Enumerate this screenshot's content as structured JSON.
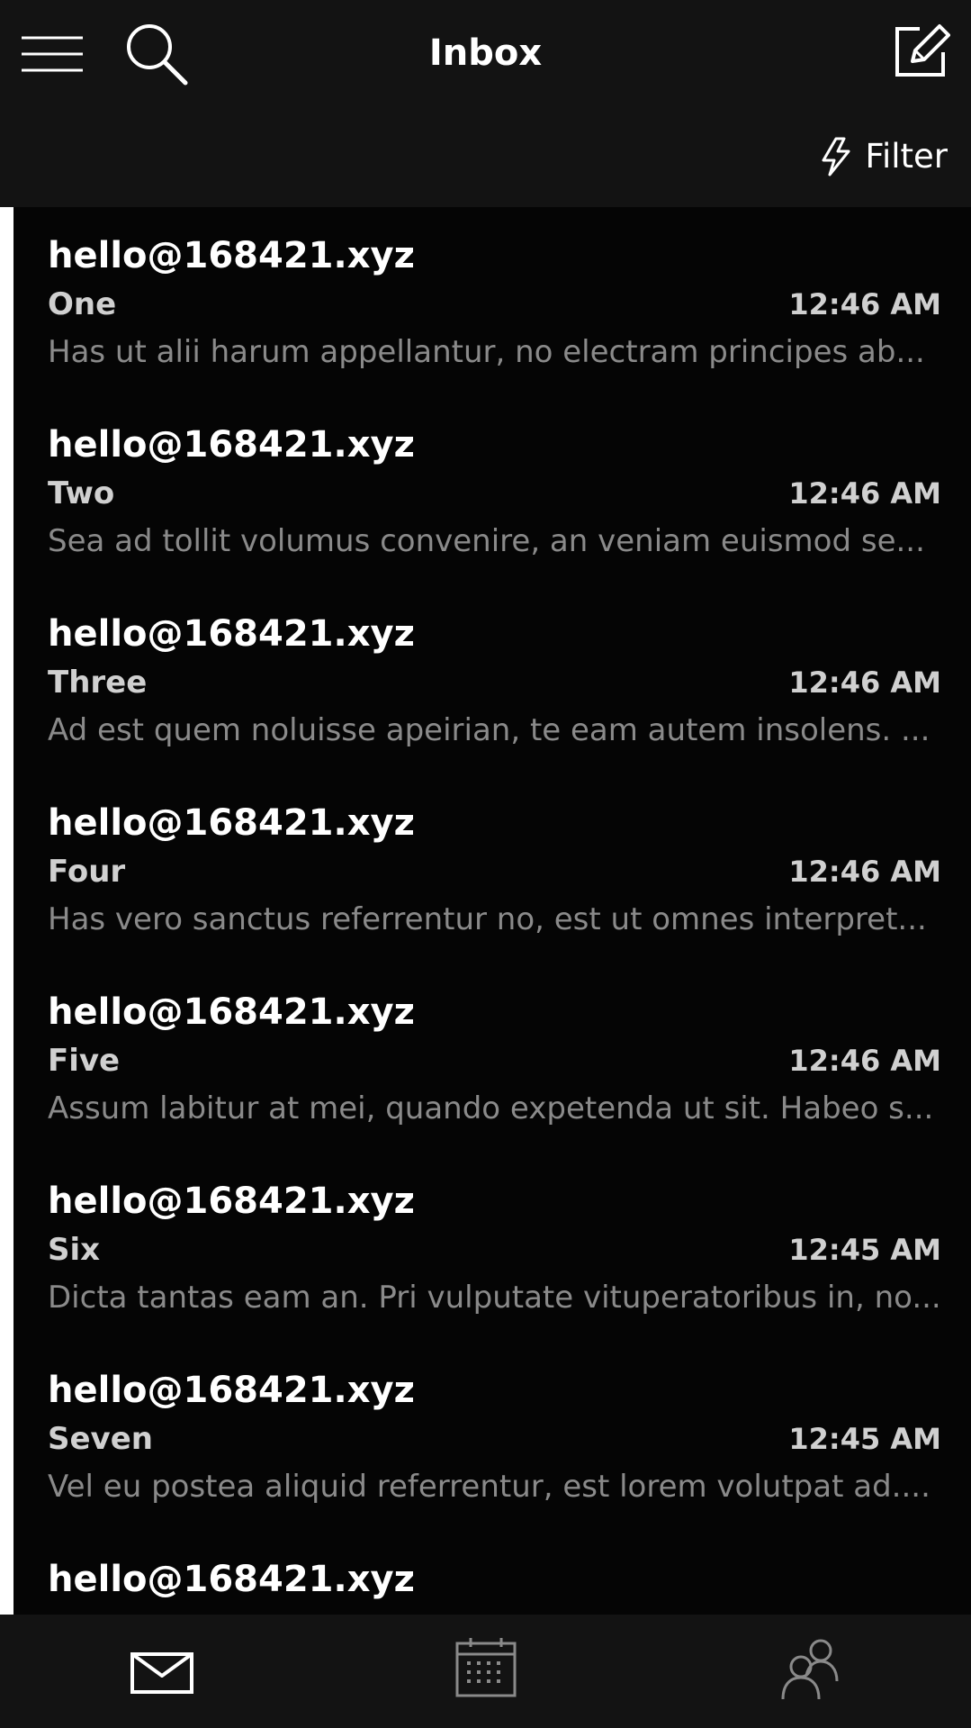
{
  "header": {
    "title": "Inbox",
    "filter_label": "Filter"
  },
  "icons": {
    "menu": "hamburger-menu-icon",
    "search": "search-icon",
    "compose": "compose-icon",
    "filter": "lightning-bolt-icon",
    "mail": "mail-icon",
    "calendar": "calendar-icon",
    "people": "people-icon"
  },
  "colors": {
    "background": "#000000",
    "header": "#131313",
    "selection_bar": "#ffffff",
    "preview_text": "#8a8a8a"
  },
  "messages": [
    {
      "sender": "hello@168421.xyz",
      "subject": "One",
      "time": "12:46 AM",
      "preview": "Has ut alii harum appellantur, no electram principes ab..."
    },
    {
      "sender": "hello@168421.xyz",
      "subject": "Two",
      "time": "12:46 AM",
      "preview": "Sea ad tollit volumus convenire, an veniam euismod se..."
    },
    {
      "sender": "hello@168421.xyz",
      "subject": "Three",
      "time": "12:46 AM",
      "preview": "Ad est quem noluisse apeirian, te eam autem insolens. ..."
    },
    {
      "sender": "hello@168421.xyz",
      "subject": "Four",
      "time": "12:46 AM",
      "preview": "Has vero sanctus referrentur no, est ut omnes interpret..."
    },
    {
      "sender": "hello@168421.xyz",
      "subject": "Five",
      "time": "12:46 AM",
      "preview": "Assum labitur at mei, quando expetenda ut sit. Habeo s..."
    },
    {
      "sender": "hello@168421.xyz",
      "subject": "Six",
      "time": "12:45 AM",
      "preview": "Dicta tantas eam an. Pri vulputate vituperatoribus in, no..."
    },
    {
      "sender": "hello@168421.xyz",
      "subject": "Seven",
      "time": "12:45 AM",
      "preview": "Vel eu postea aliquid referrentur, est lorem volutpat ad...."
    },
    {
      "sender": "hello@168421.xyz",
      "subject": "",
      "time": "",
      "preview": ""
    }
  ]
}
